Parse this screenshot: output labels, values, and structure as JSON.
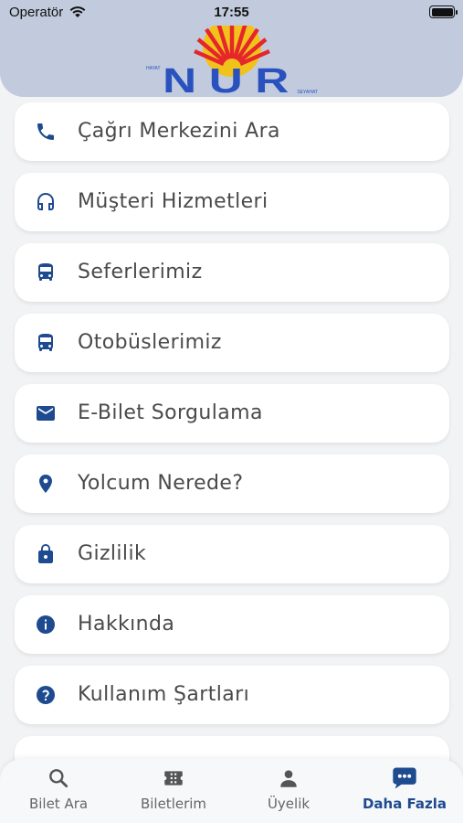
{
  "status_bar": {
    "carrier": "Operatör",
    "time": "17:55"
  },
  "logo": {
    "brand": "NUR",
    "small_left": "HAYAT",
    "small_right": "SEYAHAT"
  },
  "colors": {
    "accent": "#1e4a8f",
    "header_bg": "#c1cbdd",
    "label": "#4a4a4a"
  },
  "menu": {
    "items": [
      {
        "label": "Çağrı Merkezini Ara",
        "icon": "phone-icon"
      },
      {
        "label": "Müşteri Hizmetleri",
        "icon": "headset-icon"
      },
      {
        "label": "Seferlerimiz",
        "icon": "bus-icon"
      },
      {
        "label": "Otobüslerimiz",
        "icon": "bus-icon"
      },
      {
        "label": "E-Bilet Sorgulama",
        "icon": "mail-icon"
      },
      {
        "label": "Yolcum Nerede?",
        "icon": "location-pin-icon"
      },
      {
        "label": "Gizlilik",
        "icon": "lock-icon"
      },
      {
        "label": "Hakkında",
        "icon": "info-icon"
      },
      {
        "label": "Kullanım Şartları",
        "icon": "help-icon"
      },
      {
        "label": "",
        "icon": ""
      }
    ]
  },
  "tabbar": {
    "tabs": [
      {
        "label": "Bilet Ara",
        "icon": "search-icon",
        "active": false
      },
      {
        "label": "Biletlerim",
        "icon": "ticket-icon",
        "active": false
      },
      {
        "label": "Üyelik",
        "icon": "person-icon",
        "active": false
      },
      {
        "label": "Daha Fazla",
        "icon": "more-chat-icon",
        "active": true
      }
    ]
  }
}
